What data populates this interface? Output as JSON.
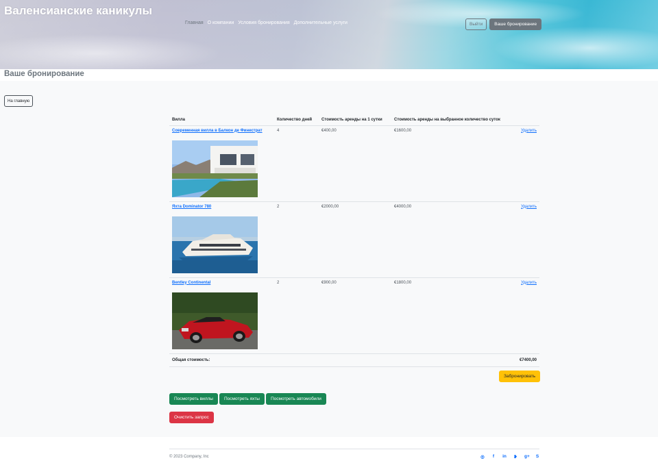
{
  "header": {
    "brand": "Валенсианские каникулы",
    "nav": [
      "Главная",
      "О компании",
      "Условия бронирования",
      "Дополнительные услуги"
    ],
    "logout_label": "Выйти",
    "booking_label": "Ваше бронирование"
  },
  "page": {
    "title": "Ваше бронирование",
    "home_button": "На главную"
  },
  "table": {
    "columns": [
      "Вилла",
      "Количество дней",
      "Стоимость аренды на 1 сутки",
      "Стоимость аренды на выбранное количество суток"
    ],
    "rows": [
      {
        "name": "Современная вилла в Балкон де Финестрат",
        "days": "4",
        "price_per_day": "€400,00",
        "price_total": "€1600,00",
        "delete_label": "Удалить",
        "image": "villa-photo"
      },
      {
        "name": "Яхта Dominator 780",
        "days": "2",
        "price_per_day": "€2000,00",
        "price_total": "€4000,00",
        "delete_label": "Удалить",
        "image": "yacht-photo"
      },
      {
        "name": "Bentley Continental",
        "days": "2",
        "price_per_day": "€900,00",
        "price_total": "€1800,00",
        "delete_label": "Удалить",
        "image": "car-photo"
      }
    ],
    "total_label": "Общая стоимость:",
    "total_value": "€7400,00"
  },
  "actions": {
    "book": "Забронировать",
    "view_villas": "Посмотреть виллы",
    "view_yachts": "Посмотреть яхты",
    "view_cars": "Посмотреть автомобили",
    "clear": "Очистить запрос"
  },
  "footer": {
    "copyright": "© 2023 Company, Inc",
    "social_icons": [
      "instagram-icon",
      "facebook-icon",
      "linkedin-icon",
      "twitter-icon",
      "google-plus-icon",
      "skype-icon"
    ]
  },
  "colors": {
    "primary": "#0d6efd",
    "success": "#198754",
    "danger": "#dc3545",
    "warning": "#ffc107",
    "secondary": "#6c757d"
  }
}
